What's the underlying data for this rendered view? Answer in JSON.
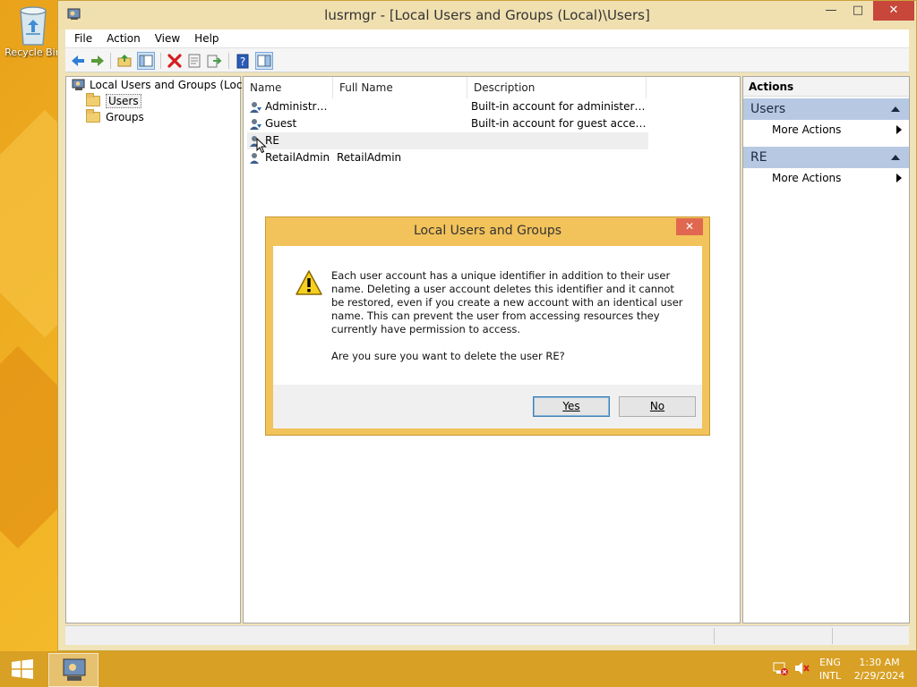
{
  "desktop": {
    "recycle_bin_label": "Recycle Bin"
  },
  "window": {
    "title": "lusrmgr - [Local Users and Groups (Local)\\Users]",
    "controls": {
      "minimize": "—",
      "maximize": "□",
      "close": "✕"
    }
  },
  "menu": {
    "items": [
      "File",
      "Action",
      "View",
      "Help"
    ]
  },
  "toolbar": {
    "icons": [
      "back-icon",
      "forward-icon",
      "up-folder-icon",
      "show-hide-tree-icon",
      "delete-icon",
      "properties-icon",
      "export-list-icon",
      "help-icon",
      "show-hide-action-pane-icon"
    ]
  },
  "tree": {
    "root": "Local Users and Groups (Local)",
    "children": [
      "Users",
      "Groups"
    ]
  },
  "list": {
    "columns": [
      "Name",
      "Full Name",
      "Description"
    ],
    "rows": [
      {
        "name": "Administrator",
        "full_name": "",
        "description": "Built-in account for administering..."
      },
      {
        "name": "Guest",
        "full_name": "",
        "description": "Built-in account for guest access t..."
      },
      {
        "name": "RE",
        "full_name": "",
        "description": ""
      },
      {
        "name": "RetailAdmin",
        "full_name": "RetailAdmin",
        "description": ""
      }
    ],
    "selected_row": 2
  },
  "actions": {
    "header": "Actions",
    "sections": [
      {
        "title": "Users",
        "item": "More Actions"
      },
      {
        "title": "RE",
        "item": "More Actions"
      }
    ]
  },
  "dialog": {
    "title": "Local Users and Groups",
    "close": "✕",
    "message": "Each user account has a unique identifier in addition to their user name. Deleting a user account deletes this identifier and it cannot be restored, even if you create a new account with an identical user name. This can prevent the user from accessing resources they currently have permission to access.",
    "question": "Are you sure you want to delete the user RE?",
    "yes_label": "Yes",
    "no_label": "No"
  },
  "taskbar": {
    "language_top": "ENG",
    "language_bottom": "INTL",
    "time": "1:30 AM",
    "date": "2/29/2024"
  },
  "colors": {
    "accent_window": "#f0e0b0",
    "action_section": "#b7c9e2",
    "dialog_frame": "#f2c25b",
    "close_red": "#c7473a"
  }
}
